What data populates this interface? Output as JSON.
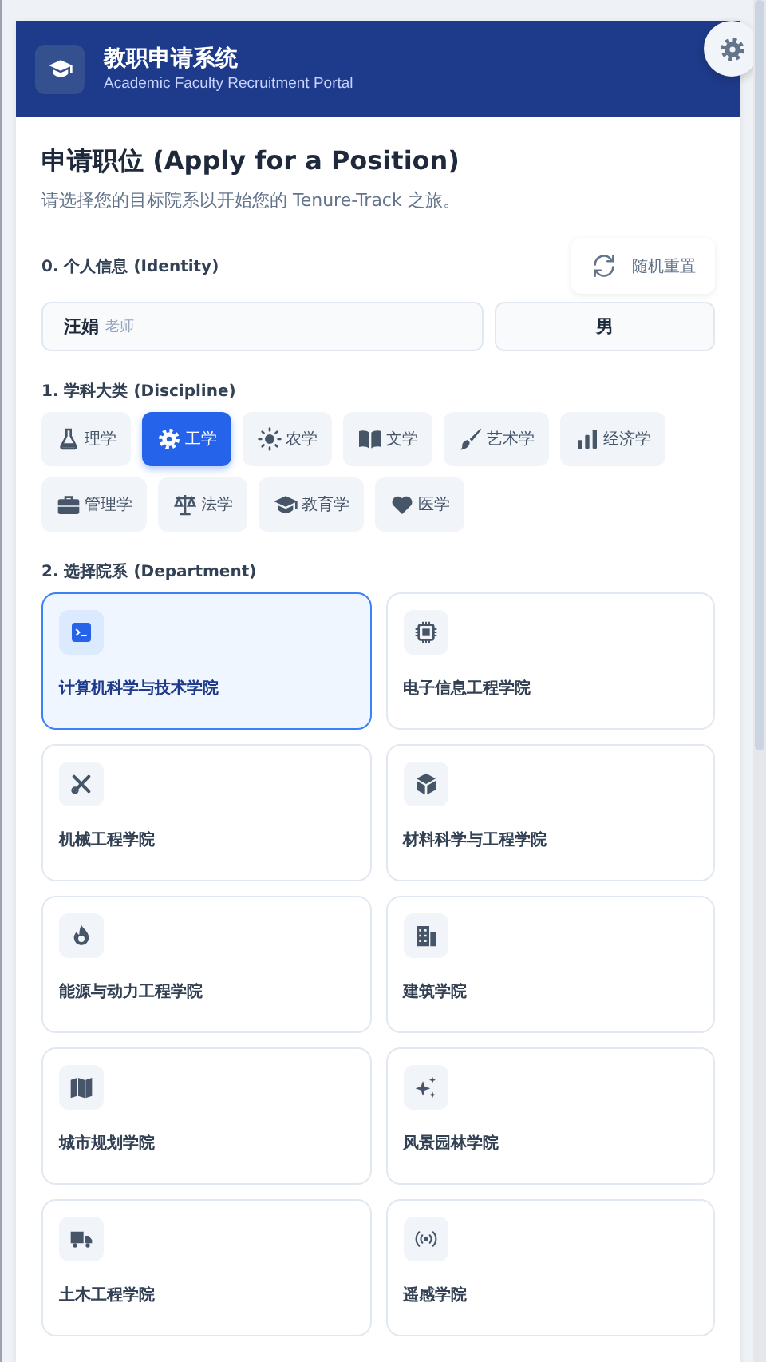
{
  "header": {
    "title": "教职申请系统",
    "subtitle": "Academic Faculty Recruitment Portal"
  },
  "page": {
    "title": "申请职位 (Apply for a Position)",
    "subtitle": "请选择您的目标院系以开始您的 Tenure-Track 之旅。"
  },
  "identity": {
    "label": "0. 个人信息 (Identity)",
    "reset_button": "随机重置",
    "name": "汪娟",
    "honorific": "老师",
    "gender": "男"
  },
  "discipline": {
    "label": "1. 学科大类 (Discipline)",
    "items": [
      {
        "label": "理学",
        "selected": false
      },
      {
        "label": "工学",
        "selected": true
      },
      {
        "label": "农学",
        "selected": false
      },
      {
        "label": "文学",
        "selected": false
      },
      {
        "label": "艺术学",
        "selected": false
      },
      {
        "label": "经济学",
        "selected": false
      },
      {
        "label": "管理学",
        "selected": false
      },
      {
        "label": "法学",
        "selected": false
      },
      {
        "label": "教育学",
        "selected": false
      },
      {
        "label": "医学",
        "selected": false
      }
    ]
  },
  "department": {
    "label": "2. 选择院系 (Department)",
    "items": [
      {
        "label": "计算机科学与技术学院",
        "selected": true
      },
      {
        "label": "电子信息工程学院",
        "selected": false
      },
      {
        "label": "机械工程学院",
        "selected": false
      },
      {
        "label": "材料科学与工程学院",
        "selected": false
      },
      {
        "label": "能源与动力工程学院",
        "selected": false
      },
      {
        "label": "建筑学院",
        "selected": false
      },
      {
        "label": "城市规划学院",
        "selected": false
      },
      {
        "label": "风景园林学院",
        "selected": false
      },
      {
        "label": "土木工程学院",
        "selected": false
      },
      {
        "label": "遥感学院",
        "selected": false
      }
    ]
  }
}
